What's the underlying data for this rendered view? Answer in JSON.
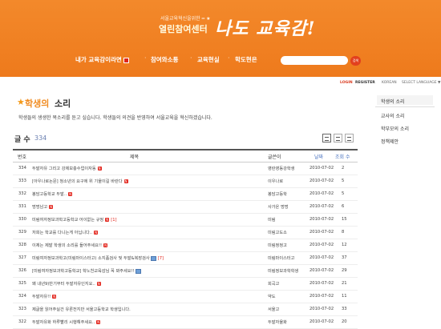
{
  "header": {
    "logo_subtitle": "서울교육혁신을위한 ━ ★",
    "logo_title": "열린참여센터",
    "logo_handwriting": "나도 교육감!",
    "nav": [
      {
        "label": "내가 교육감이라면",
        "has_new": true
      },
      {
        "label": "참여와소통",
        "has_new": false
      },
      {
        "label": "교육현실",
        "has_new": false
      },
      {
        "label": "학도현은",
        "has_new": false
      }
    ],
    "search_placeholder": "",
    "search_button": "검색"
  },
  "util_links": [
    "LOGIN",
    "REGISTER",
    "KOREAN",
    "SELECT LANGUAGE ▼"
  ],
  "page": {
    "title_accent": "학생의",
    "title_rest": "소리",
    "intro": "학생들의 생생한 목소리를 듣고 싶습니다. 학생들의 의견을 반영하여 서울교육을 혁신하겠습니다.",
    "count_label": "글 수",
    "count_value": "334"
  },
  "table": {
    "headers": [
      "번호",
      "제목",
      "글쓴이",
      "날짜",
      "조회 수"
    ],
    "rows": [
      {
        "no": "334",
        "title": "두발자유 그리고 강제보충수업이자동",
        "new": true,
        "comments": "",
        "img": false,
        "author": "영란영동강학생",
        "date": "2010-07-02",
        "views": "2"
      },
      {
        "no": "333",
        "title": "[아우나로논문] 청소년의 요구에 위 기울이길 바란다",
        "new": true,
        "comments": "",
        "img": false,
        "author": "이우나로",
        "date": "2010-07-02",
        "views": "5"
      },
      {
        "no": "332",
        "title": "봉담고등학교 두발..",
        "new": true,
        "comments": "",
        "img": false,
        "author": "봉담고등학",
        "date": "2010-07-02",
        "views": "5"
      },
      {
        "no": "331",
        "title": "멍멍남고",
        "new": true,
        "comments": "",
        "img": false,
        "author": "사가온 멍멍",
        "date": "2010-07-02",
        "views": "6"
      },
      {
        "no": "330",
        "title": "미림여자정보과학고등학교 어이없는 규정",
        "new": true,
        "comments": "[1]",
        "img": false,
        "author": "미림",
        "date": "2010-07-02",
        "views": "15"
      },
      {
        "no": "329",
        "title": "저희는 학교를 다니는게 아닙니다..",
        "new": true,
        "comments": "",
        "img": false,
        "author": "미림고도소",
        "date": "2010-07-02",
        "views": "8"
      },
      {
        "no": "328",
        "title": "이제는 제발 학생의 소리를 들어주세요!!",
        "new": true,
        "comments": "",
        "img": false,
        "author": "미림정정고",
        "date": "2010-07-02",
        "views": "12"
      },
      {
        "no": "327",
        "title": "미림여자정보과학고(미림마이스터고) 소지품검사 및 두발&복장검사",
        "new": false,
        "comments": "[7]",
        "img": true,
        "author": "미림마이스터고",
        "date": "2010-07-02",
        "views": "37"
      },
      {
        "no": "326",
        "title": "[미림여자정보과학고등학교] 학노천교육감님 꼭 봐주세요!!",
        "new": false,
        "comments": "",
        "img": true,
        "author": "미림정보과학학생",
        "date": "2010-07-02",
        "views": "29"
      },
      {
        "no": "325",
        "title": "왜 내년9)반기부터 두발자유인지요..",
        "new": true,
        "comments": "",
        "img": false,
        "author": "회곡고",
        "date": "2010-07-02",
        "views": "21"
      },
      {
        "no": "324",
        "title": "두발자유!!",
        "new": true,
        "comments": "",
        "img": false,
        "author": "약도",
        "date": "2010-07-02",
        "views": "11"
      },
      {
        "no": "323",
        "title": "제글을 읽어주실건 유론전지만 서울고등학교 학생입니다.",
        "new": false,
        "comments": "",
        "img": false,
        "author": "서울고",
        "date": "2010-07-02",
        "views": "33"
      },
      {
        "no": "322",
        "title": "두발자유화 하루빨리 시행해주세요..",
        "new": true,
        "comments": "",
        "img": false,
        "author": "두발자율화",
        "date": "2010-07-02",
        "views": "20"
      }
    ]
  },
  "sidebar": {
    "items": [
      "학생의 소리",
      "교사의 소리",
      "학부모의 소리",
      "정책제안"
    ]
  },
  "colors": {
    "header_orange": "#f08a2a",
    "accent_orange": "#f08a1e",
    "new_red": "#e2231a",
    "link_blue": "#4a73c0"
  }
}
